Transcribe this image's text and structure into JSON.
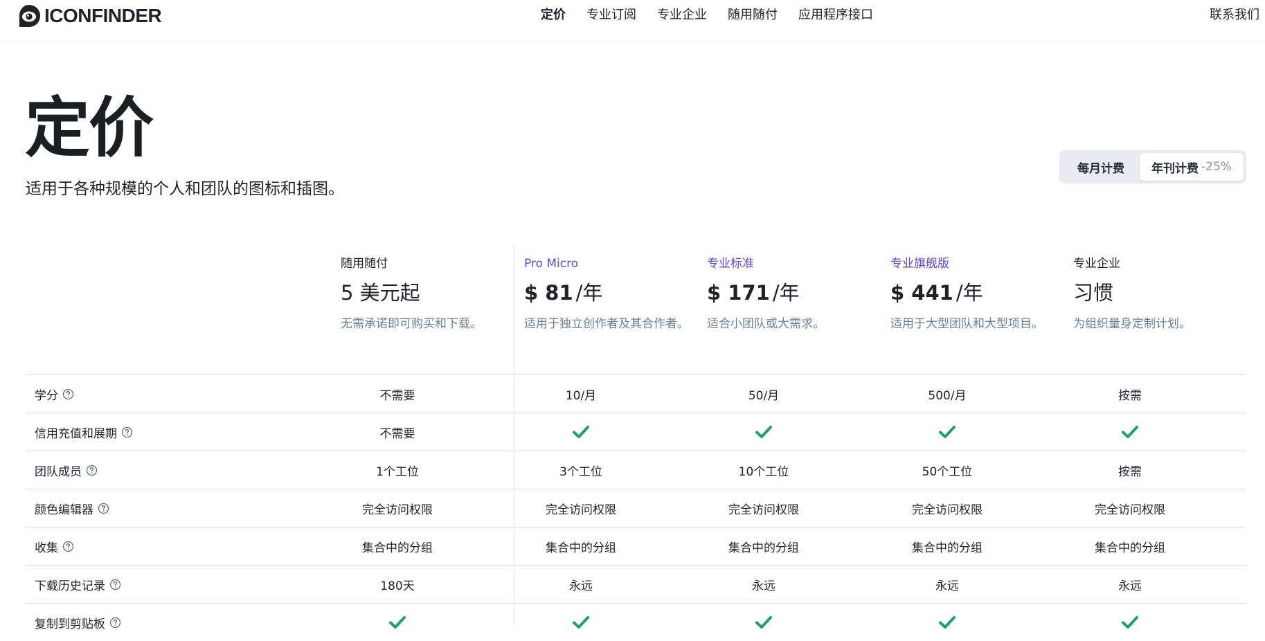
{
  "header": {
    "logo_text": "ICONFINDER",
    "nav": [
      {
        "label": "定价",
        "active": true
      },
      {
        "label": "专业订阅",
        "active": false
      },
      {
        "label": "专业企业",
        "active": false
      },
      {
        "label": "随用随付",
        "active": false
      },
      {
        "label": "应用程序接口",
        "active": false
      }
    ],
    "contact_label": "联系我们"
  },
  "hero": {
    "title": "定价",
    "subtitle": "适用于各种规模的个人和团队的图标和插图。"
  },
  "billing_toggle": {
    "monthly_label": "每月计费",
    "yearly_label": "年刊计费",
    "yearly_discount": "-25%",
    "selected": "yearly"
  },
  "plans": [
    {
      "name": "随用随付",
      "price_amount": "5 美元起",
      "price_period": "",
      "description": "无需承诺即可购买和下载。",
      "highlight": false
    },
    {
      "name": "Pro Micro",
      "price_amount": "$ 81",
      "price_period": "/年",
      "description": "适用于独立创作者及其合作者。",
      "highlight": true
    },
    {
      "name": "专业标准",
      "price_amount": "$ 171",
      "price_period": "/年",
      "description": "适合小团队或大需求。",
      "highlight": true
    },
    {
      "name": "专业旗舰版",
      "price_amount": "$ 441",
      "price_period": "/年",
      "description": "适用于大型团队和大型项目。",
      "highlight": true
    },
    {
      "name": "专业企业",
      "price_amount": "习惯",
      "price_period": "",
      "description": "为组织量身定制计划。",
      "highlight": false
    }
  ],
  "features": [
    {
      "label": "学分",
      "values": [
        "不需要",
        "10/月",
        "50/月",
        "500/月",
        "按需"
      ]
    },
    {
      "label": "信用充值和展期",
      "values": [
        "不需要",
        "check",
        "check",
        "check",
        "check"
      ]
    },
    {
      "label": "团队成员",
      "values": [
        "1个工位",
        "3个工位",
        "10个工位",
        "50个工位",
        "按需"
      ]
    },
    {
      "label": "颜色编辑器",
      "values": [
        "完全访问权限",
        "完全访问权限",
        "完全访问权限",
        "完全访问权限",
        "完全访问权限"
      ]
    },
    {
      "label": "收集",
      "values": [
        "集合中的分组",
        "集合中的分组",
        "集合中的分组",
        "集合中的分组",
        "集合中的分组"
      ]
    },
    {
      "label": "下载历史记录",
      "values": [
        "180天",
        "永远",
        "永远",
        "永远",
        "永远"
      ]
    },
    {
      "label": "复制到剪贴板",
      "values": [
        "check",
        "check",
        "check",
        "check",
        "check"
      ]
    }
  ],
  "colors": {
    "accent": "#6045d6",
    "check": "#1f9d78",
    "muted_text": "#6b7f94",
    "border": "#dcdfe3"
  },
  "icons": {
    "logo": "eye-logo-icon",
    "help": "question-circle-icon",
    "check": "check-icon"
  }
}
